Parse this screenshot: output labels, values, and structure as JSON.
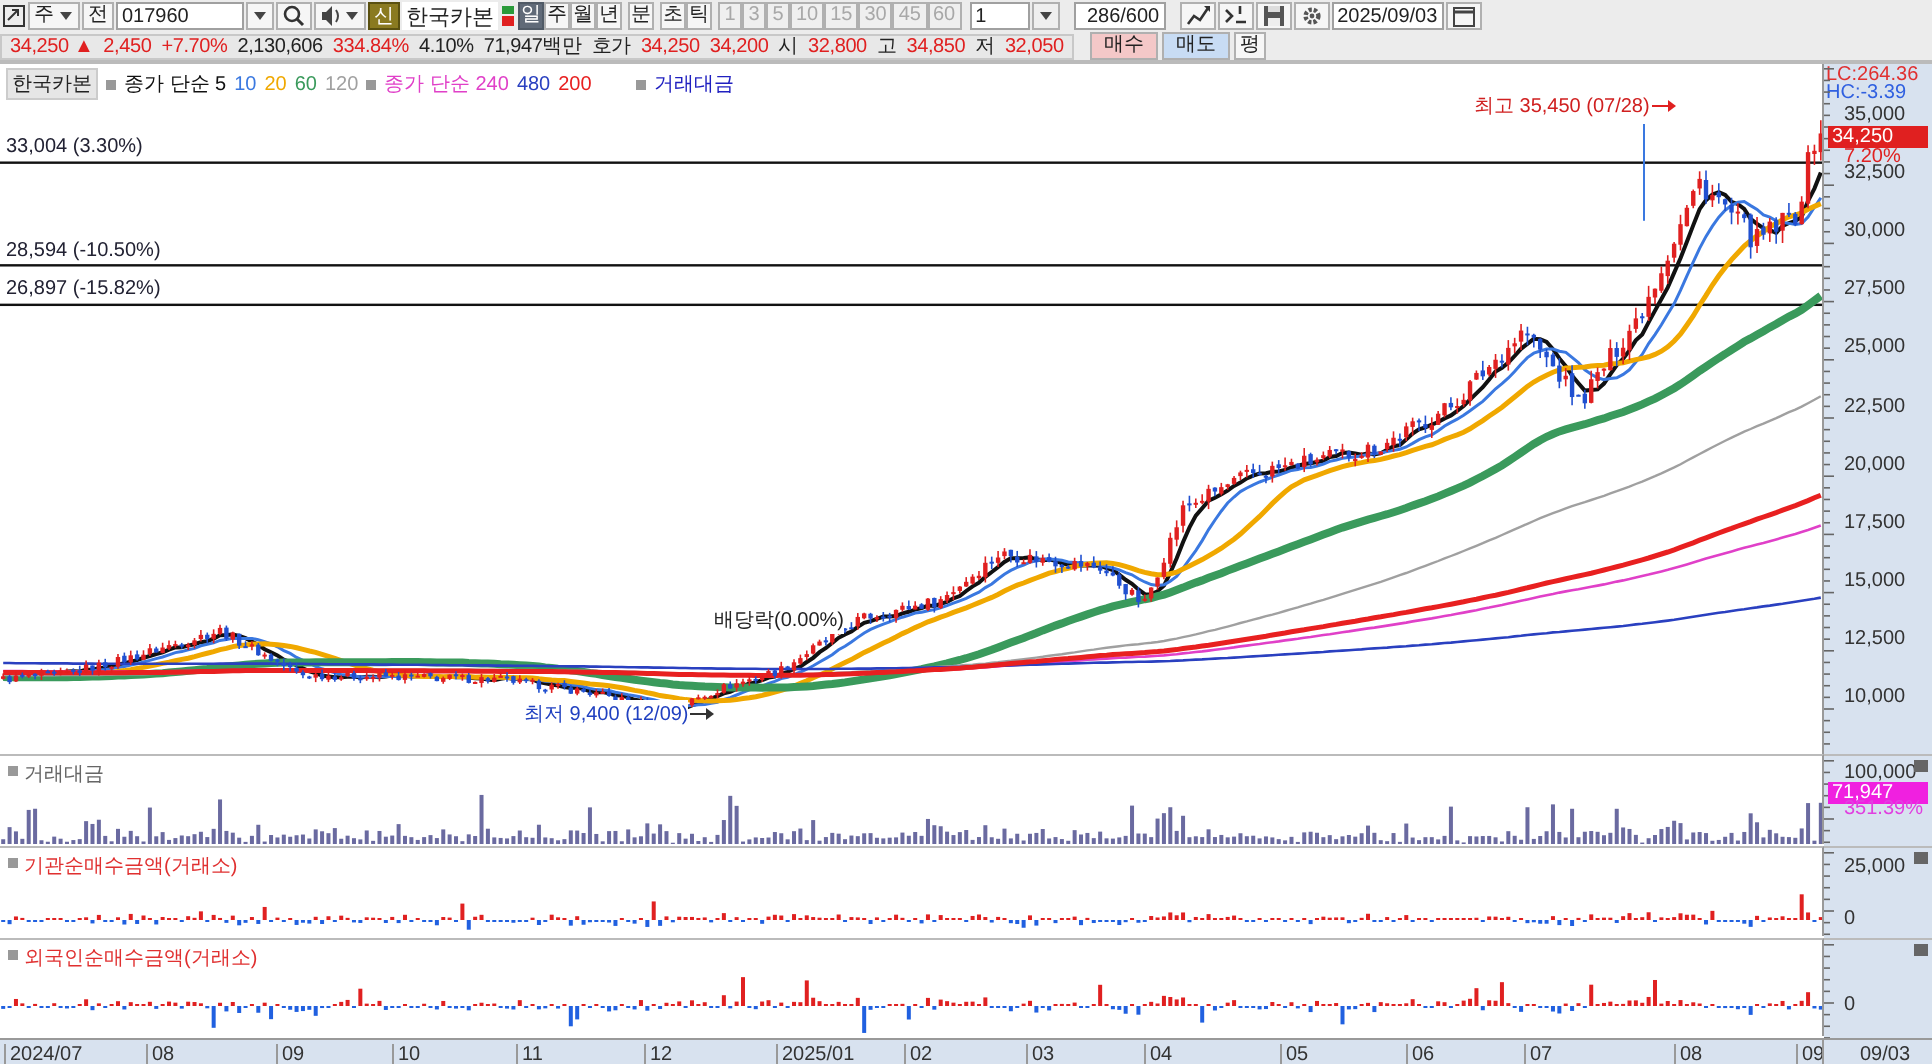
{
  "toolbar": {
    "market": "주",
    "all_button": "전",
    "code": "017960",
    "new_badge": "신",
    "stock_name": "한국카본",
    "periods": [
      {
        "label": "일",
        "selected": true
      },
      {
        "label": "주",
        "selected": false
      },
      {
        "label": "월",
        "selected": false
      },
      {
        "label": "년",
        "selected": false
      },
      {
        "label": "분",
        "selected": false
      },
      {
        "label": "초",
        "selected": false
      },
      {
        "label": "틱",
        "selected": false
      }
    ],
    "intervals": [
      {
        "label": "1",
        "disabled": true
      },
      {
        "label": "3",
        "disabled": true
      },
      {
        "label": "5",
        "disabled": true
      },
      {
        "label": "10",
        "disabled": true
      },
      {
        "label": "15",
        "disabled": true
      },
      {
        "label": "30",
        "disabled": true
      },
      {
        "label": "45",
        "disabled": true
      },
      {
        "label": "60",
        "disabled": true
      }
    ],
    "interval_value": "1",
    "bar_count": "286/600",
    "date": "2025/09/03"
  },
  "quote": {
    "items": [
      {
        "text": "34,250 ▲",
        "color": "#e02020"
      },
      {
        "text": "2,450",
        "color": "#e02020"
      },
      {
        "text": "+7.70%",
        "color": "#e02020"
      },
      {
        "text": "2,130,606",
        "color": "#222222"
      },
      {
        "text": "334.84%",
        "color": "#e02020"
      },
      {
        "text": "4.10%",
        "color": "#222222"
      },
      {
        "text": "71,947백만",
        "color": "#222222"
      },
      {
        "text": "호가",
        "color": "#222222"
      },
      {
        "text": "34,250",
        "color": "#e02020"
      },
      {
        "text": "34,200",
        "color": "#e02020"
      },
      {
        "text": "시",
        "color": "#222222"
      },
      {
        "text": "32,800",
        "color": "#e02020"
      },
      {
        "text": "고",
        "color": "#222222"
      },
      {
        "text": "34,850",
        "color": "#e02020"
      },
      {
        "text": "저",
        "color": "#222222"
      },
      {
        "text": "32,050",
        "color": "#e02020"
      }
    ],
    "buttons": [
      {
        "label": "매수",
        "kind": "buy"
      },
      {
        "label": "매도",
        "kind": "sell"
      },
      {
        "label": "평",
        "kind": "plain"
      }
    ]
  },
  "legend": {
    "title": "한국카본",
    "items": [
      {
        "label": "종가 단순 5",
        "color": "#111111"
      },
      {
        "label": "10",
        "color": "#3a78e0"
      },
      {
        "label": "20",
        "color": "#f0a800"
      },
      {
        "label": "60",
        "color": "#3a9a5c"
      },
      {
        "label": "120",
        "color": "#a0a0a0"
      },
      {
        "label": "종가 단순 240",
        "color": "#e040c8"
      },
      {
        "label": "480",
        "color": "#2a40c0"
      },
      {
        "label": "200",
        "color": "#e82020"
      }
    ],
    "volume_label": "거래대금",
    "lc": "LC:264.36",
    "hc": "HC:-3.39"
  },
  "price_panel": {
    "levels": [
      {
        "label": "33,004 (3.30%)"
      },
      {
        "label": "28,594 (-10.50%)"
      },
      {
        "label": "26,897 (-15.82%)"
      }
    ],
    "high_note": "최고 35,450 (07/28)",
    "low_note": "최저 9,400 (12/09)",
    "dividend_note": "배당락(0.00%)",
    "axis_ticks": [
      "35,000",
      "32,500",
      "30,000",
      "27,500",
      "25,000",
      "22,500",
      "20,000",
      "17,500",
      "15,000",
      "12,500",
      "10,000"
    ],
    "last_price": "34,250",
    "last_change": "7.20%"
  },
  "volume_panel": {
    "title": "거래대금",
    "axis_ticks": [
      "100,000"
    ],
    "last_value": "71,947",
    "last_ratio": "351.39%"
  },
  "institution_panel": {
    "title": "기관순매수금액(거래소)",
    "axis_ticks": [
      "25,000",
      "0"
    ]
  },
  "foreign_panel": {
    "title": "외국인순매수금액(거래소)",
    "axis_ticks": [
      "0"
    ]
  },
  "x_axis": {
    "labels": [
      "2024/07",
      "08",
      "09",
      "10",
      "11",
      "12",
      "2025/01",
      "02",
      "03",
      "04",
      "05",
      "06",
      "07",
      "08",
      "09"
    ],
    "last_date": "09/03"
  }
}
